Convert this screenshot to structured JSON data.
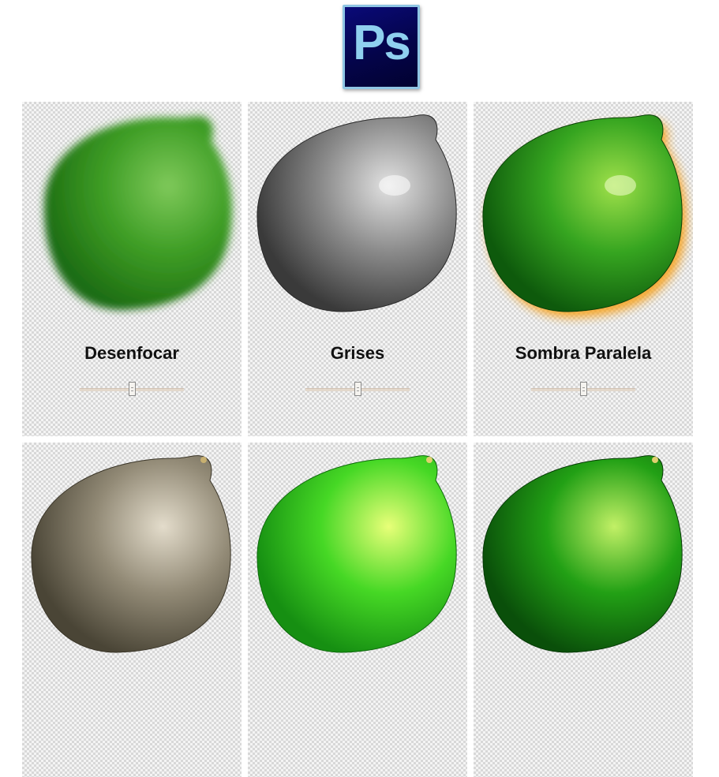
{
  "header": {
    "logo_text": "Ps",
    "logo_icon": "photoshop-icon"
  },
  "cards": [
    {
      "label": "Desenfocar",
      "effect": "blur",
      "slider_value": 0.5,
      "colors": {
        "light": "#7fc95a",
        "mid": "#3f9e26",
        "dark": "#1d6d12"
      }
    },
    {
      "label": "Grises",
      "effect": "grayscale",
      "slider_value": 0.5,
      "colors": {
        "light": "#e2e2e2",
        "mid": "#8a8a8a",
        "dark": "#3a3a3a"
      }
    },
    {
      "label": "Sombra Paralela",
      "effect": "drop-shadow",
      "slider_value": 0.5,
      "colors": {
        "light": "#9fe04a",
        "mid": "#36a520",
        "dark": "#0e5a0c",
        "glow": "#f7a21a"
      }
    },
    {
      "label": "",
      "effect": "sepia",
      "colors": {
        "light": "#e3dccb",
        "mid": "#928a76",
        "dark": "#4a4536"
      }
    },
    {
      "label": "",
      "effect": "brighten",
      "colors": {
        "light": "#e8ff78",
        "mid": "#46d825",
        "dark": "#168f12"
      }
    },
    {
      "label": "",
      "effect": "contrast",
      "colors": {
        "light": "#c2f066",
        "mid": "#22a015",
        "dark": "#0a4f0a"
      }
    }
  ]
}
